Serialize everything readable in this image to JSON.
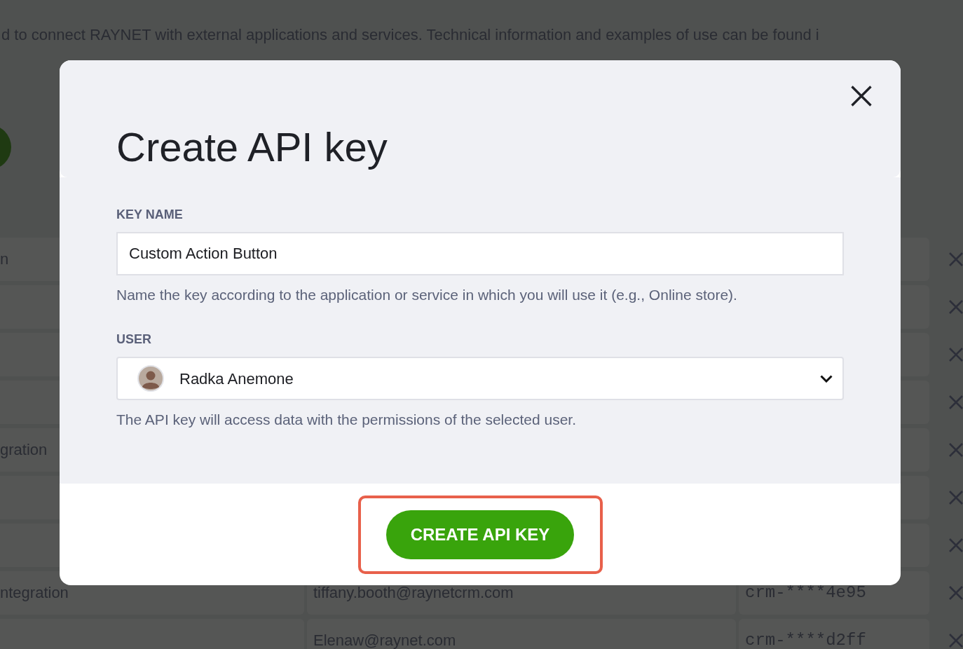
{
  "background_page": {
    "intro_text": "d to connect RAYNET with external applications and services. Technical information and examples of use can be found i",
    "rows": [
      {
        "column_1": "n"
      },
      {},
      {},
      {},
      {
        "column_1": "gration"
      },
      {},
      {},
      {
        "column_1": "ntegration",
        "column_2": "tiffany.booth@raynetcrm.com",
        "column_3": "crm-****4e95"
      },
      {
        "column_2": "Elenaw@raynet.com",
        "column_3": "crm-****d2ff"
      }
    ]
  },
  "dialog": {
    "title": "Create API key",
    "fields": [
      {
        "kind": "text",
        "label": "KEY NAME",
        "value": "Custom Action Button",
        "hint": "Name the key according to the application or service in which you will use it (e.g., Online store)."
      },
      {
        "kind": "select",
        "label": "USER",
        "value": "Radka Anemone",
        "hint": "The API key will access data with the permissions of the selected user."
      }
    ],
    "primary_button": {
      "label": "CREATE API KEY",
      "highlighted": true
    }
  }
}
